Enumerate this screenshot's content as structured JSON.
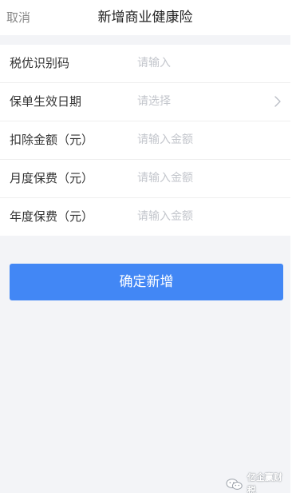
{
  "nav": {
    "cancel_label": "取消",
    "title": "新增商业健康险"
  },
  "form": {
    "rows": [
      {
        "label": "税优识别码",
        "placeholder": "请输入",
        "kind": "input"
      },
      {
        "label": "保单生效日期",
        "placeholder": "请选择",
        "kind": "select",
        "icon": "chevron-right-icon"
      },
      {
        "label": "扣除金额（元）",
        "placeholder": "请输入金额",
        "kind": "input"
      },
      {
        "label": "月度保费（元）",
        "placeholder": "请输入金额",
        "kind": "input"
      },
      {
        "label": "年度保费（元）",
        "placeholder": "请输入金额",
        "kind": "input"
      }
    ]
  },
  "submit": {
    "label": "确定新增"
  },
  "watermark": {
    "text": "亿企赢财税",
    "icon": "wechat-icon"
  },
  "colors": {
    "accent": "#4287f5",
    "page_background": "#f3f4f7",
    "placeholder": "#c3c6cc"
  }
}
